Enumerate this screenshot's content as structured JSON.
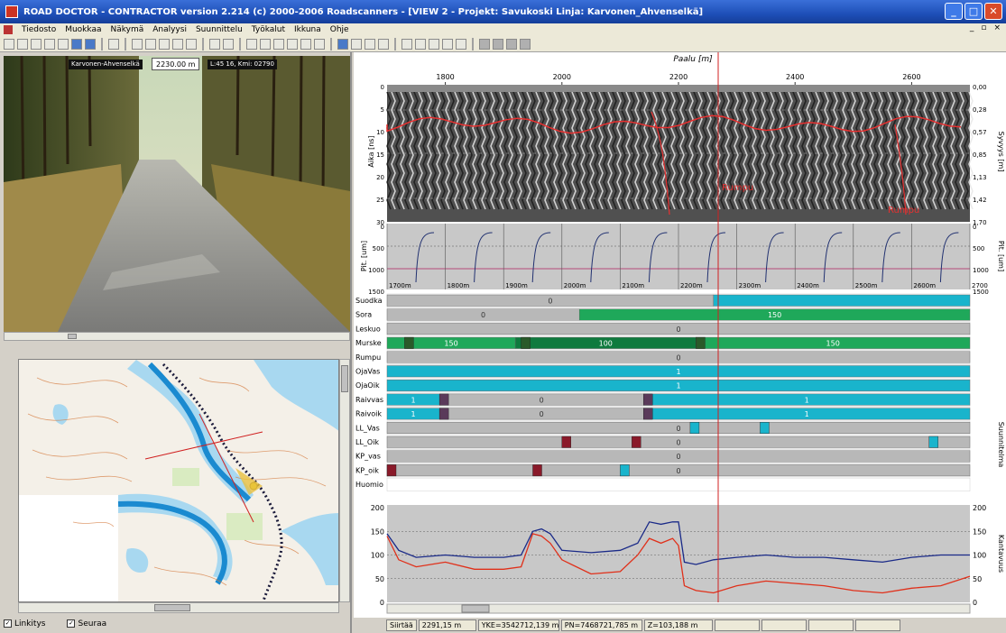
{
  "window": {
    "title": "ROAD DOCTOR - CONTRACTOR version 2.214 (c) 2000-2006 Roadscanners - [VIEW 2 - Projekt: Savukoski Linja: Karvonen_Ahvenselkä]",
    "min": "_",
    "max": "□",
    "close": "✕"
  },
  "menu": {
    "items": [
      "Tiedosto",
      "Muokkaa",
      "Näkymä",
      "Analyysi",
      "Suunnittelu",
      "Työkalut",
      "Ikkuna",
      "Ohje"
    ],
    "right": [
      "_",
      "▫",
      "×"
    ]
  },
  "photo": {
    "overlay_left": "Karvonen-Ahvenselkä",
    "overlay_value": "2230.00 m",
    "overlay_right": "L:45 16, Kmi: 02790"
  },
  "map_status": {
    "item1": "Linkitys",
    "item2": "Seuraa"
  },
  "chart": {
    "x_title": "Paalu [m]",
    "x_ticks": [
      "1800",
      "2000",
      "2200",
      "2400",
      "2600"
    ],
    "gpr": {
      "left_label": "Aika [ns]",
      "left_ticks": [
        "0",
        "5",
        "10",
        "15",
        "20",
        "25",
        "30"
      ],
      "right_label": "Syvyys [m]",
      "right_ticks": [
        "0,00",
        "0,28",
        "0,57",
        "0,85",
        "1,13",
        "1,42",
        "1,70"
      ],
      "annotation1": "Rumpu",
      "annotation2": "Rumpu"
    },
    "fwd": {
      "left_label": "Pit. [um]",
      "left_ticks": [
        "0",
        "500",
        "1000",
        "1500"
      ],
      "right_label": "Pit. [um]",
      "right_ticks": [
        "0",
        "500",
        "1000",
        "1500"
      ],
      "station_labels": [
        "1700m",
        "1800m",
        "1900m",
        "2000m",
        "2100m",
        "2200m",
        "2300m",
        "2400m",
        "2500m",
        "2600m",
        "2700"
      ]
    },
    "layers": {
      "right_label": "Suunnitelma",
      "rows": [
        {
          "name": "Suodka",
          "bars": [
            {
              "from": 0,
              "to": 0.56,
              "color": "#b8b8b8",
              "label": "0"
            },
            {
              "from": 0.56,
              "to": 1,
              "color": "#19b4cc",
              "label": ""
            }
          ]
        },
        {
          "name": "Sora",
          "bars": [
            {
              "from": 0,
              "to": 0.33,
              "color": "#b8b8b8",
              "label": "0"
            },
            {
              "from": 0.33,
              "to": 1,
              "color": "#1fa85a",
              "label": "150"
            }
          ]
        },
        {
          "name": "Leskuo",
          "bars": [
            {
              "from": 0,
              "to": 1,
              "color": "#b8b8b8",
              "label": "0"
            }
          ]
        },
        {
          "name": "Murske",
          "bars": [
            {
              "from": 0,
              "to": 0.22,
              "color": "#1fa85a",
              "label": "150"
            },
            {
              "from": 0.22,
              "to": 0.53,
              "color": "#0f7a3e",
              "label": "100"
            },
            {
              "from": 0.53,
              "to": 1,
              "color": "#1fa85a",
              "label": "150"
            }
          ]
        },
        {
          "name": "Rumpu",
          "bars": [
            {
              "from": 0,
              "to": 1,
              "color": "#b8b8b8",
              "label": "0"
            }
          ]
        },
        {
          "name": "OjaVas",
          "bars": [
            {
              "from": 0,
              "to": 1,
              "color": "#19b4cc",
              "label": "1"
            }
          ]
        },
        {
          "name": "OjaOik",
          "bars": [
            {
              "from": 0,
              "to": 1,
              "color": "#19b4cc",
              "label": "1"
            }
          ]
        },
        {
          "name": "Raivvas",
          "bars": [
            {
              "from": 0,
              "to": 0.09,
              "color": "#19b4cc",
              "label": "1"
            },
            {
              "from": 0.09,
              "to": 0.44,
              "color": "#b8b8b8",
              "label": "0"
            },
            {
              "from": 0.44,
              "to": 1,
              "color": "#19b4cc",
              "label": "1"
            }
          ]
        },
        {
          "name": "Raivoik",
          "bars": [
            {
              "from": 0,
              "to": 0.09,
              "color": "#19b4cc",
              "label": "1"
            },
            {
              "from": 0.09,
              "to": 0.44,
              "color": "#b8b8b8",
              "label": "0"
            },
            {
              "from": 0.44,
              "to": 1,
              "color": "#19b4cc",
              "label": "1"
            }
          ]
        },
        {
          "name": "LL_Vas",
          "bars": [
            {
              "from": 0,
              "to": 1,
              "color": "#b8b8b8",
              "label": "0"
            }
          ]
        },
        {
          "name": "LL_Oik",
          "bars": [
            {
              "from": 0,
              "to": 1,
              "color": "#b8b8b8",
              "label": "0"
            }
          ]
        },
        {
          "name": "KP_vas",
          "bars": [
            {
              "from": 0,
              "to": 1,
              "color": "#b8b8b8",
              "label": "0"
            }
          ]
        },
        {
          "name": "KP_oik",
          "bars": [
            {
              "from": 0,
              "to": 1,
              "color": "#b8b8b8",
              "label": "0"
            }
          ]
        },
        {
          "name": "Huomio",
          "bars": []
        }
      ]
    },
    "profile": {
      "left_ticks": [
        "200",
        "150",
        "100",
        "50",
        "0"
      ],
      "right_ticks": [
        "200",
        "150",
        "100",
        "50",
        "0"
      ],
      "right_label": "Kantavuus",
      "ylim": [
        0,
        200
      ],
      "x_range": [
        1700,
        2700
      ],
      "blue": [
        [
          1700,
          145
        ],
        [
          1720,
          110
        ],
        [
          1750,
          95
        ],
        [
          1800,
          100
        ],
        [
          1850,
          95
        ],
        [
          1900,
          95
        ],
        [
          1930,
          100
        ],
        [
          1950,
          150
        ],
        [
          1965,
          155
        ],
        [
          1980,
          145
        ],
        [
          2000,
          110
        ],
        [
          2050,
          105
        ],
        [
          2100,
          110
        ],
        [
          2130,
          125
        ],
        [
          2150,
          170
        ],
        [
          2170,
          165
        ],
        [
          2190,
          170
        ],
        [
          2200,
          170
        ],
        [
          2210,
          85
        ],
        [
          2230,
          80
        ],
        [
          2260,
          90
        ],
        [
          2300,
          95
        ],
        [
          2350,
          100
        ],
        [
          2400,
          95
        ],
        [
          2450,
          95
        ],
        [
          2500,
          90
        ],
        [
          2550,
          85
        ],
        [
          2600,
          95
        ],
        [
          2650,
          100
        ],
        [
          2700,
          100
        ]
      ],
      "red": [
        [
          1700,
          140
        ],
        [
          1720,
          90
        ],
        [
          1750,
          75
        ],
        [
          1800,
          85
        ],
        [
          1850,
          70
        ],
        [
          1900,
          70
        ],
        [
          1930,
          75
        ],
        [
          1950,
          145
        ],
        [
          1965,
          140
        ],
        [
          1980,
          125
        ],
        [
          2000,
          90
        ],
        [
          2050,
          60
        ],
        [
          2100,
          65
        ],
        [
          2130,
          100
        ],
        [
          2150,
          135
        ],
        [
          2170,
          125
        ],
        [
          2190,
          135
        ],
        [
          2200,
          120
        ],
        [
          2210,
          35
        ],
        [
          2230,
          25
        ],
        [
          2260,
          20
        ],
        [
          2300,
          35
        ],
        [
          2350,
          45
        ],
        [
          2400,
          40
        ],
        [
          2450,
          35
        ],
        [
          2500,
          25
        ],
        [
          2550,
          20
        ],
        [
          2600,
          30
        ],
        [
          2650,
          35
        ],
        [
          2700,
          55
        ]
      ]
    }
  },
  "statusbar": [
    "Siirtää",
    "2291,15 m",
    "YKE=3542712,139 m",
    "PN=7468721,785 m",
    "Z=103,188 m"
  ]
}
